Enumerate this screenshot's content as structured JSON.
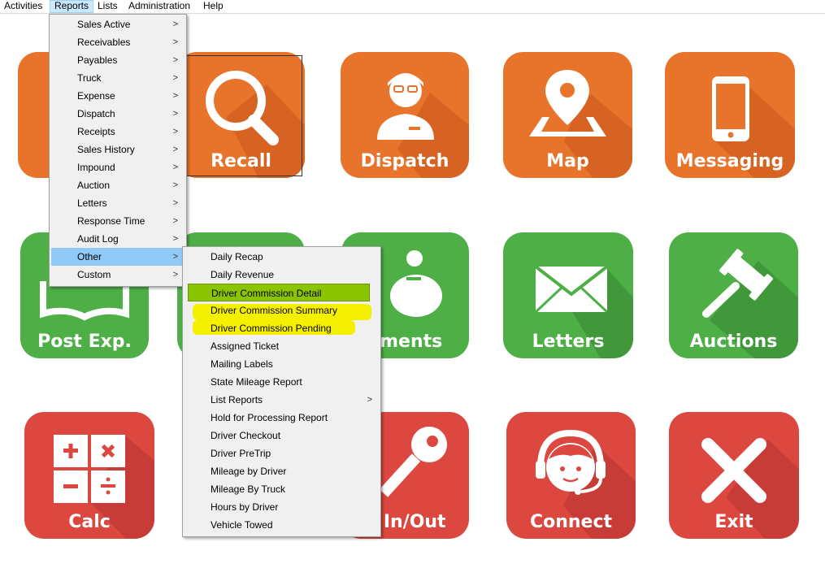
{
  "menubar": {
    "items": [
      {
        "label": "Activities"
      },
      {
        "label": "Reports"
      },
      {
        "label": "Lists"
      },
      {
        "label": "Administration"
      },
      {
        "label": "Help"
      }
    ]
  },
  "tiles": {
    "recall": "Recall",
    "dispatch": "Dispatch",
    "map": "Map",
    "messaging": "Messaging",
    "post_exp": "Post Exp.",
    "payments": "yments",
    "letters": "Letters",
    "auctions": "Auctions",
    "calc": "Calc",
    "log_in_out": "g In/Out",
    "connect": "Connect",
    "exit": "Exit"
  },
  "reports_menu": {
    "items": [
      "Sales Active",
      "Receivables",
      "Payables",
      "Truck",
      "Expense",
      "Dispatch",
      "Receipts",
      "Sales History",
      "Impound",
      "Auction",
      "Letters",
      "Response Time",
      "Audit Log",
      "Other",
      "Custom"
    ]
  },
  "other_menu": {
    "items": [
      "Daily Recap",
      "Daily Revenue",
      "Driver Commission Detail",
      "Driver Commission Summary",
      "Driver Commission Pending",
      "Assigned Ticket",
      "Mailing Labels",
      "State Mileage Report",
      "List Reports",
      "Hold for Processing Report",
      "Driver Checkout",
      "Driver PreTrip",
      "Mileage by Driver",
      "Mileage By Truck",
      "Hours by Driver",
      "Vehicle Towed"
    ]
  },
  "colors": {
    "orange": "#e8732a",
    "green": "#4eaf47",
    "red": "#dc473f",
    "menu_highlight": "#91c9f7",
    "green_highlight": "#8bc400",
    "yellow_highlight": "#f5f000"
  }
}
